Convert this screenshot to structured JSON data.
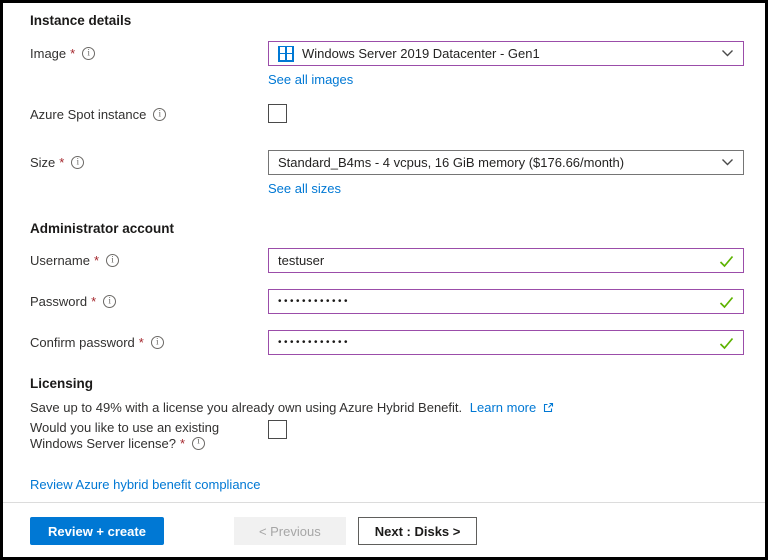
{
  "colors": {
    "link_blue": "#0078d4",
    "primary_button_blue": "#0078d4",
    "edited_field_border_purple": "#9b4da9",
    "valid_check_green": "#5db300",
    "required_asterisk_red": "#a4262c",
    "windows_logo_blue": "#0078d4"
  },
  "instance_details": {
    "title": "Instance details",
    "image": {
      "label": "Image",
      "required": "*",
      "value": "Windows Server 2019 Datacenter - Gen1",
      "see_all_link": "See all images"
    },
    "azure_spot": {
      "label": "Azure Spot instance",
      "checked": false
    },
    "size": {
      "label": "Size",
      "required": "*",
      "value": "Standard_B4ms - 4 vcpus, 16 GiB memory ($176.66/month)",
      "see_all_link": "See all sizes"
    }
  },
  "administrator_account": {
    "title": "Administrator account",
    "username": {
      "label": "Username",
      "required": "*",
      "value": "testuser"
    },
    "password": {
      "label": "Password",
      "required": "*",
      "value": "••••••••••••"
    },
    "confirm_password": {
      "label": "Confirm password",
      "required": "*",
      "value": "••••••••••••"
    }
  },
  "licensing": {
    "title": "Licensing",
    "info_text": "Save up to 49% with a license you already own using Azure Hybrid Benefit.",
    "learn_more_link": "Learn more",
    "question_line1": "Would you like to use an existing",
    "question_line2": "Windows Server license?",
    "required": "*",
    "checked": false,
    "compliance_link": "Review Azure hybrid benefit compliance"
  },
  "footer": {
    "review_create_button": "Review + create",
    "previous_button": "< Previous",
    "next_button": "Next : Disks >"
  }
}
